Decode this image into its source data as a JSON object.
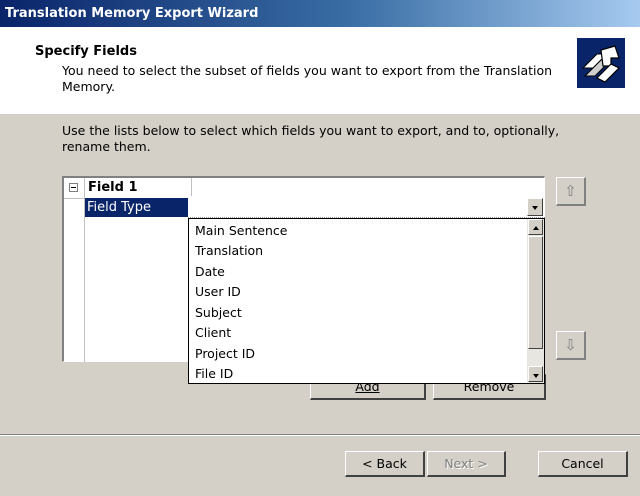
{
  "window": {
    "title": "Translation Memory Export Wizard"
  },
  "header": {
    "title": "Specify Fields",
    "description": "You need to select the subset of fields you want to export from the Translation Memory."
  },
  "instructions": "Use the lists below to select which fields you want to export, and to, optionally, rename them.",
  "grid": {
    "group_label": "Field 1",
    "selected_property": "Field Type",
    "selected_value": ""
  },
  "dropdown": {
    "options": [
      "Main Sentence",
      "Translation",
      "Date",
      "User ID",
      "Subject",
      "Client",
      "Project ID",
      "File ID"
    ]
  },
  "buttons": {
    "add": "Add",
    "remove": "Remove",
    "back": "< Back",
    "next": "Next >",
    "cancel": "Cancel",
    "move_up": "⇧",
    "move_down": "⇩"
  }
}
